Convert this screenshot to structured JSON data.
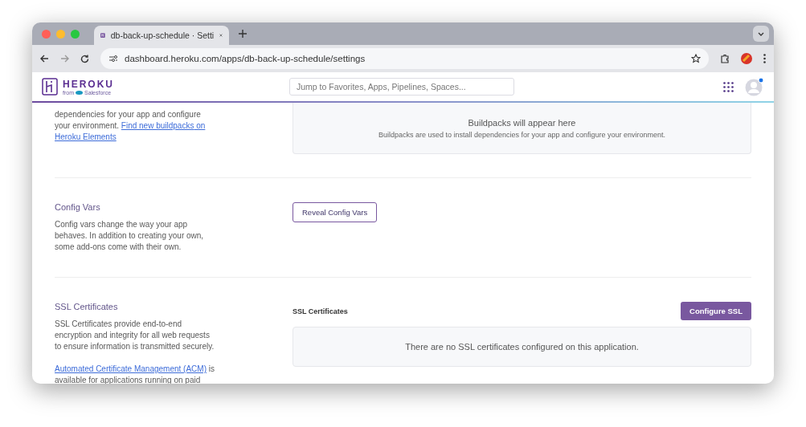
{
  "browser": {
    "tab": {
      "title": "db-back-up-schedule · Setti",
      "selected": true
    },
    "url": "dashboard.heroku.com/apps/db-back-up-schedule/settings"
  },
  "header": {
    "logo": "HEROKU",
    "logo_sub": "from",
    "logo_brand": "Salesforce",
    "search": {
      "placeholder": "Jump to Favorites, Apps, Pipelines, Spaces..."
    }
  },
  "buildpacks": {
    "description": "dependencies for your app and configure your environment.",
    "link": "Find new buildpacks on Heroku Elements",
    "empty_title": "Buildpacks will appear here",
    "empty_text": "Buildpacks are used to install dependencies for your app and configure your environment."
  },
  "config_vars": {
    "title": "Config Vars",
    "description": "Config vars change the way your app behaves. In addition to creating your own, some add-ons come with their own.",
    "button": "Reveal Config Vars"
  },
  "ssl": {
    "title": "SSL Certificates",
    "description": "SSL Certificates provide end-to-end encryption and integrity for all web requests to ensure information is transmitted securely.",
    "link": "Automated Certificate Management (ACM)",
    "link_after": "is available for applications running on paid",
    "panel_title": "SSL Certificates",
    "button": "Configure SSL",
    "empty_text": "There are no SSL certificates configured on this application."
  }
}
